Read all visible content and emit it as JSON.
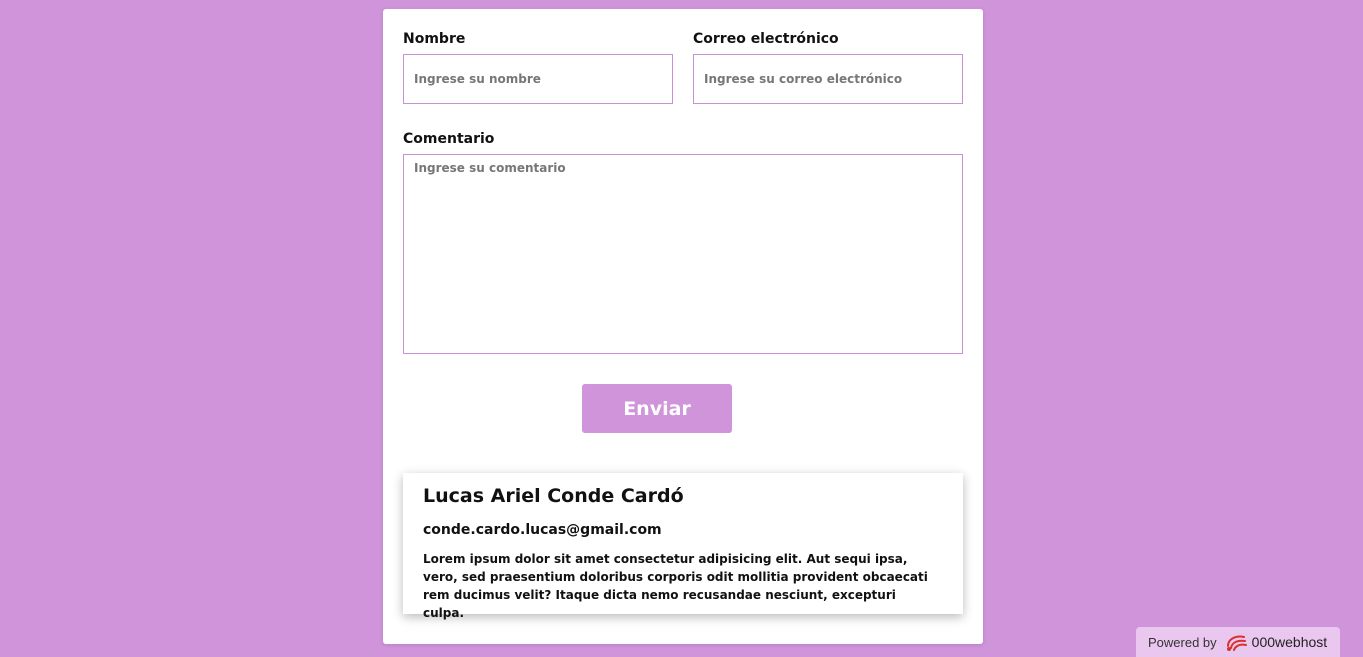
{
  "form": {
    "name_label": "Nombre",
    "name_placeholder": "Ingrese su nombre",
    "email_label": "Correo electrónico",
    "email_placeholder": "Ingrese su correo electrónico",
    "comment_label": "Comentario",
    "comment_placeholder": "Ingrese su comentario",
    "submit_label": "Enviar"
  },
  "profile": {
    "name": "Lucas Ariel Conde Cardó",
    "email": "conde.cardo.lucas@gmail.com",
    "bio": "Lorem ipsum dolor sit amet consectetur adipisicing elit. Aut sequi ipsa, vero, sed praesentium doloribus corporis odit mollitia provident obcaecati rem ducimus velit? Itaque dicta nemo recusandae nesciunt, excepturi culpa."
  },
  "footer": {
    "powered_by": "Powered by",
    "brand": "000webhost",
    "logo_icon": "000webhost-logo-icon"
  },
  "colors": {
    "background": "#cf94da",
    "accent": "#cf94da",
    "field_border": "#c98fd6",
    "card": "#ffffff"
  }
}
